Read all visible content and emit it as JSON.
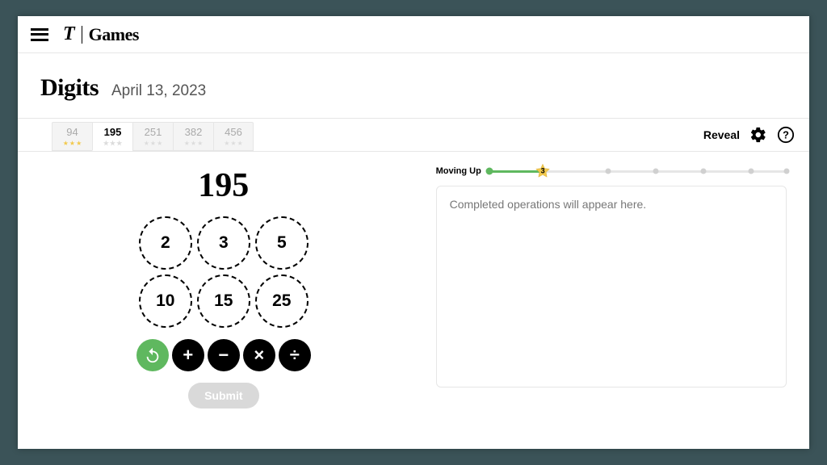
{
  "brand": {
    "t": "T",
    "games": "Games"
  },
  "header": {
    "title": "Digits",
    "date": "April 13, 2023"
  },
  "tabs": [
    {
      "label": "94",
      "done": true,
      "active": false
    },
    {
      "label": "195",
      "done": false,
      "active": true
    },
    {
      "label": "251",
      "done": false,
      "active": false
    },
    {
      "label": "382",
      "done": false,
      "active": false
    },
    {
      "label": "456",
      "done": false,
      "active": false
    }
  ],
  "toolbar": {
    "reveal": "Reveal"
  },
  "target": "195",
  "numbers": [
    "2",
    "3",
    "5",
    "10",
    "15",
    "25"
  ],
  "submit": "Submit",
  "progress": {
    "label": "Moving Up",
    "star_value": "3",
    "fill_pct": 18
  },
  "log": {
    "placeholder": "Completed operations will appear here."
  }
}
